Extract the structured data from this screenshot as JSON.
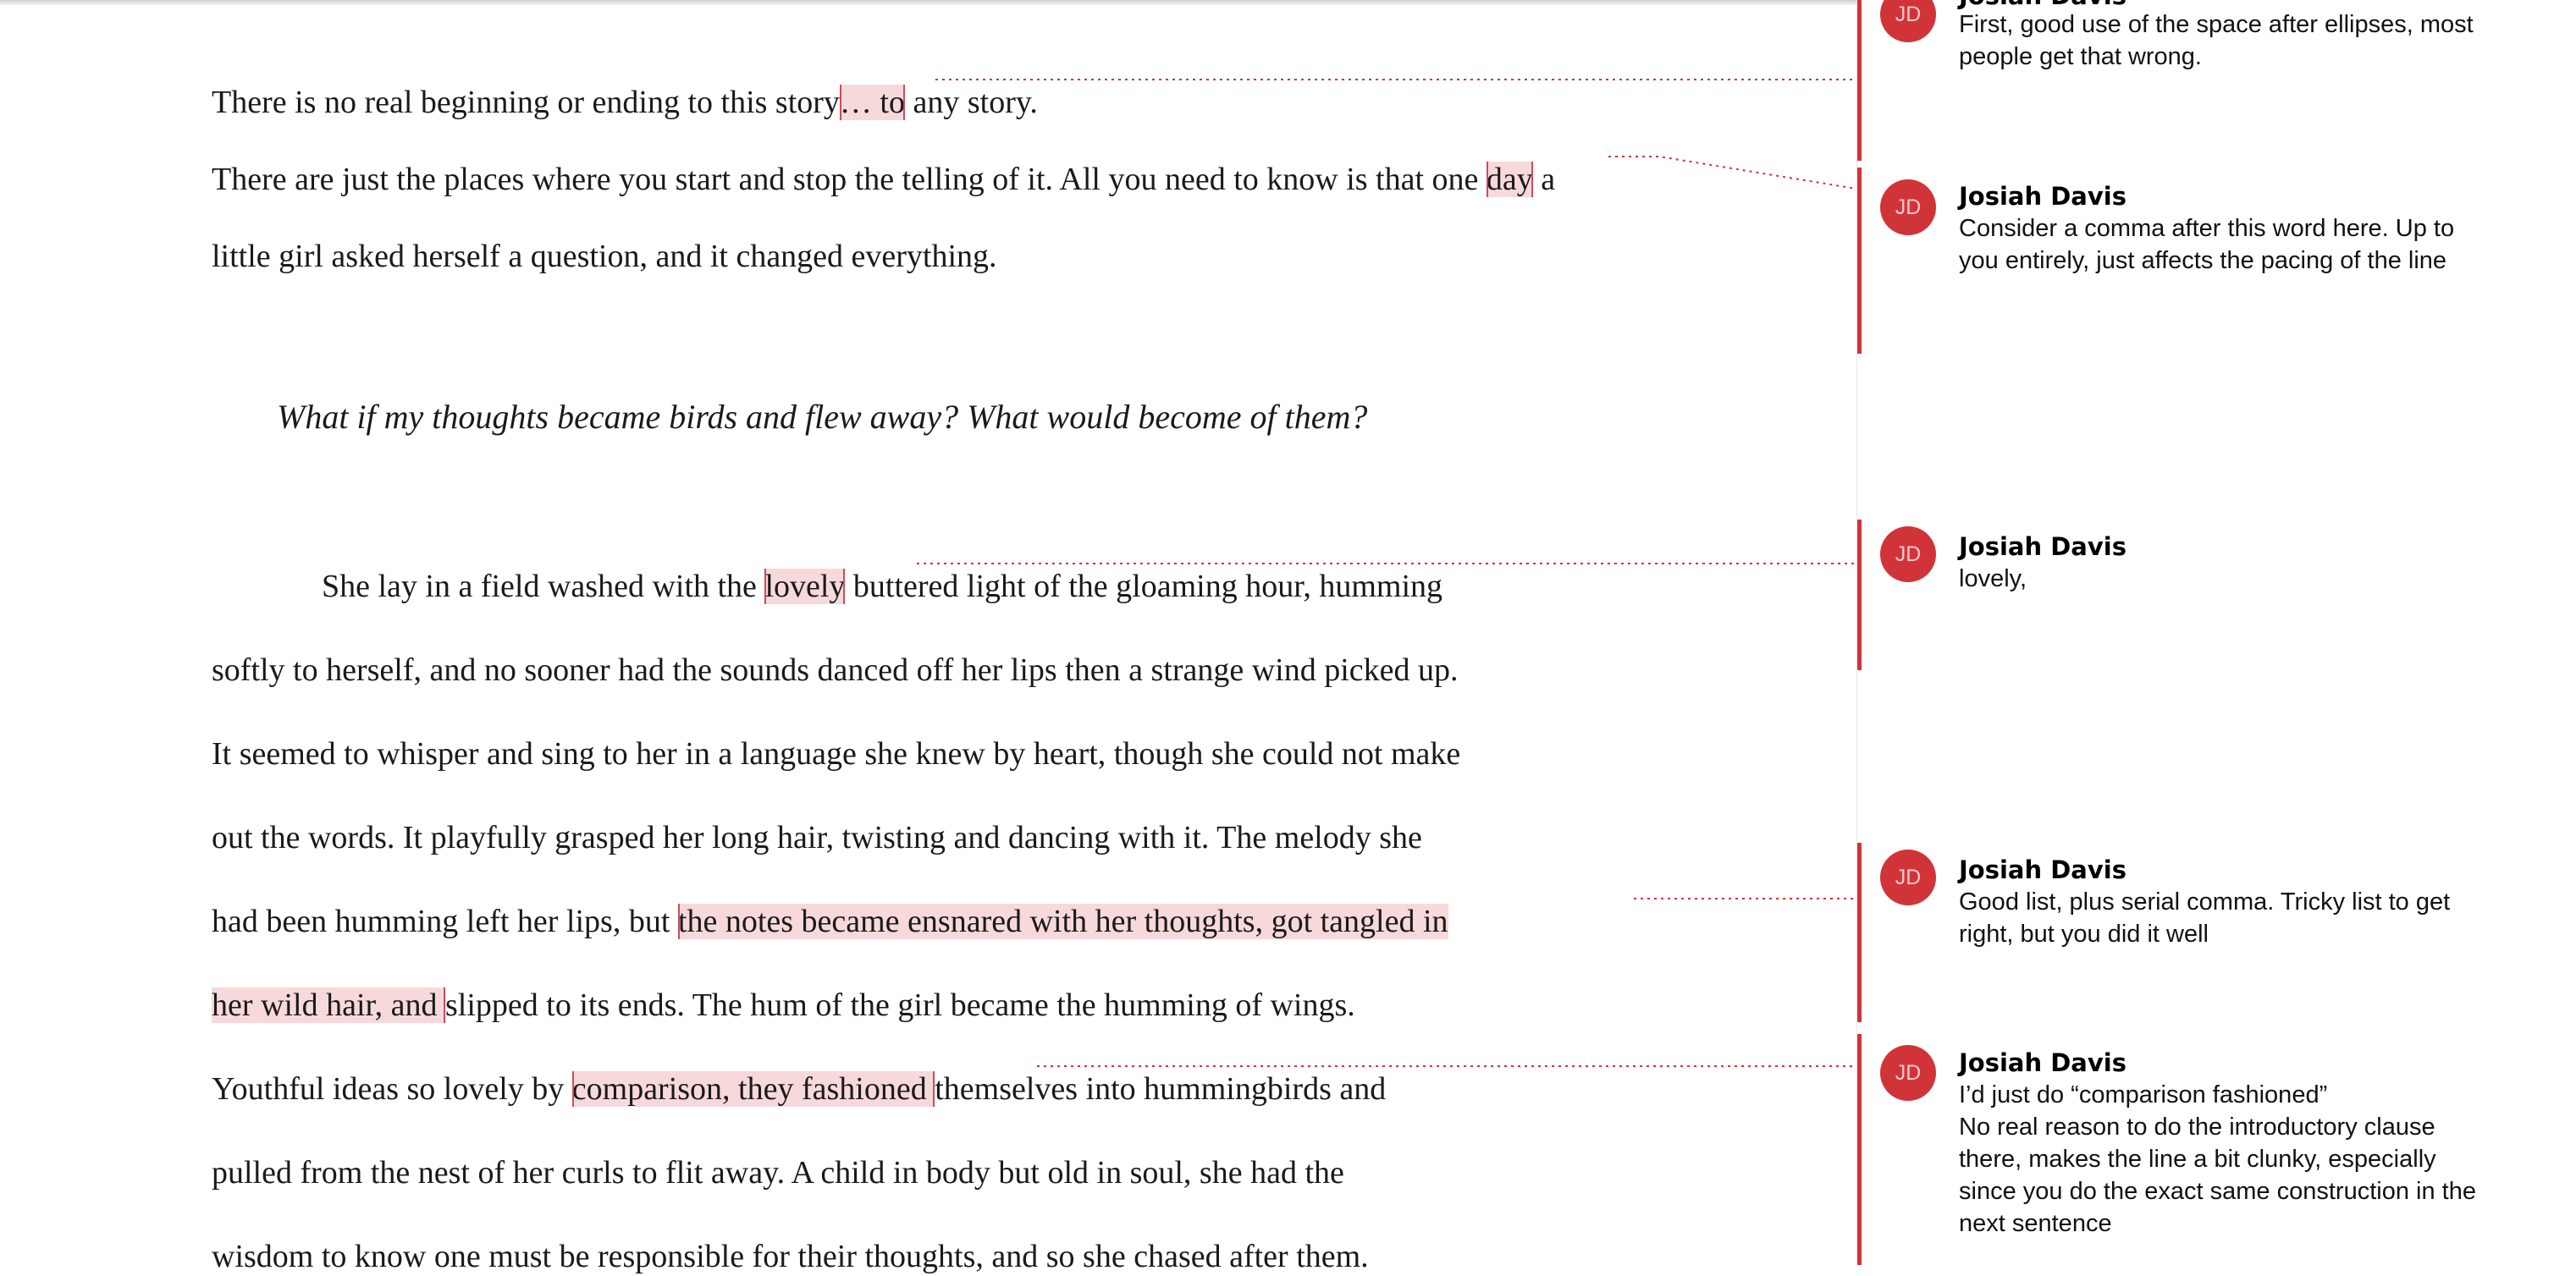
{
  "document": {
    "faded_top_text": "~ ~ ~ ~",
    "paragraph1": {
      "line1_before": "There is no real beginning or ending to this story",
      "line1_highlight": "… to",
      "line1_after": " any story.",
      "line2_before": "There are just the places where you start and stop the telling of it.  All you need to know is that one ",
      "line2_highlight": "day",
      "line2_after": " a",
      "line3": "little girl asked herself a question, and it changed everything."
    },
    "epigraph": "What if my thoughts became birds and flew away? What would become of them?",
    "paragraph2": {
      "line1_before": "She lay in a field washed with the ",
      "line1_highlight": "lovely",
      "line1_after": " buttered light of the gloaming hour, humming",
      "line2": "softly to herself, and no sooner had the sounds danced off her lips then a strange wind picked up.",
      "line3": "It seemed to whisper and sing to her in a language she knew by heart, though she could not make",
      "line4": "out the words. It playfully grasped her long hair, twisting and dancing with it. The melody she",
      "line5_before": "had been humming left her lips, but ",
      "line5_highlight": "the notes became ensnared with her thoughts, got tangled in ",
      "line6_highlight": "her wild hair, and ",
      "line6_after": "slipped to its ends. The hum of the girl became the humming of wings.",
      "line7_before": "Youthful ideas so lovely by ",
      "line7_highlight": "comparison, they fashioned ",
      "line7_after": "themselves into hummingbirds and",
      "line8": "pulled from the nest of her curls to flit away.  A child in body but old in soul, she had the",
      "line9": "wisdom to know one must be responsible for their thoughts, and so she chased after them."
    }
  },
  "comments": [
    {
      "initials": "JD",
      "author": "Josiah Davis",
      "lines": [
        "First, good use of the space after ellipses, most",
        "people get that wrong."
      ]
    },
    {
      "initials": "JD",
      "author": "Josiah Davis",
      "lines": [
        "Consider a comma after this word here. Up to",
        "you entirely, just affects the pacing of the line"
      ]
    },
    {
      "initials": "JD",
      "author": "Josiah Davis",
      "lines": [
        "lovely,"
      ]
    },
    {
      "initials": "JD",
      "author": "Josiah Davis",
      "lines": [
        "Good list, plus serial comma. Tricky list to get",
        "right, but you did it well"
      ]
    },
    {
      "initials": "JD",
      "author": "Josiah Davis",
      "lines": [
        "I’d just do “comparison fashioned”",
        "No real reason to do the introductory clause",
        "there, makes the line a bit clunky, especially",
        "since you do the exact same construction in the",
        "next sentence"
      ]
    }
  ],
  "colors": {
    "accent": "#d13438",
    "highlight": "#f8d9db"
  }
}
